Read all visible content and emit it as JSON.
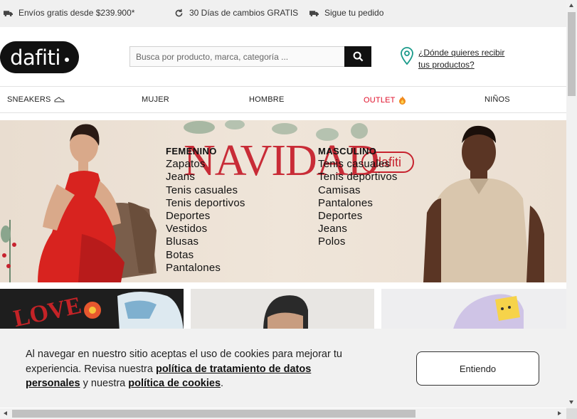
{
  "promo": {
    "items": [
      {
        "icon": "truck-icon",
        "label": "Envíos gratis desde $239.900*"
      },
      {
        "icon": "refresh-icon",
        "label": "30 Días de cambios GRATIS"
      },
      {
        "icon": "truck-icon",
        "label": "Sigue tu pedido"
      }
    ]
  },
  "header": {
    "logo_text": "dafiti",
    "search_placeholder": "Busca por producto, marca, categoría ...",
    "location_text": "¿Dónde quieres recibir tus productos?"
  },
  "nav": {
    "items": [
      {
        "label": "SNEAKERS"
      },
      {
        "label": "MUJER"
      },
      {
        "label": "HOMBRE"
      },
      {
        "label": "OUTLET"
      },
      {
        "label": "NIÑOS"
      }
    ]
  },
  "hero": {
    "bg_title": "NAVIDAD",
    "bg_logo": "dafiti",
    "femenino": {
      "heading": "FEMENINO",
      "links": [
        "Zapatos",
        "Jeans",
        "Tenis casuales",
        "Tenis deportivos",
        "Deportes",
        "Vestidos",
        "Blusas",
        "Botas",
        "Pantalones"
      ]
    },
    "masculino": {
      "heading": "MASCULINO",
      "links": [
        "Tenis casuales",
        "Tenis deportivos",
        "Camisas",
        "Pantalones",
        "Deportes",
        "Jeans",
        "Polos"
      ]
    }
  },
  "cookie": {
    "text_1": "Al navegar en nuestro sitio aceptas el uso de cookies para mejorar tu experiencia. Revisa nuestra ",
    "link_1": "política de tratamiento de datos personales",
    "text_2": " y nuestra ",
    "link_2": "política de cookies",
    "text_3": ".",
    "button": "Entiendo"
  },
  "colors": {
    "outlet": "#e0112b",
    "brand_black": "#111111",
    "hero_red": "#c7232f",
    "location_icon": "#1a9a8a"
  }
}
